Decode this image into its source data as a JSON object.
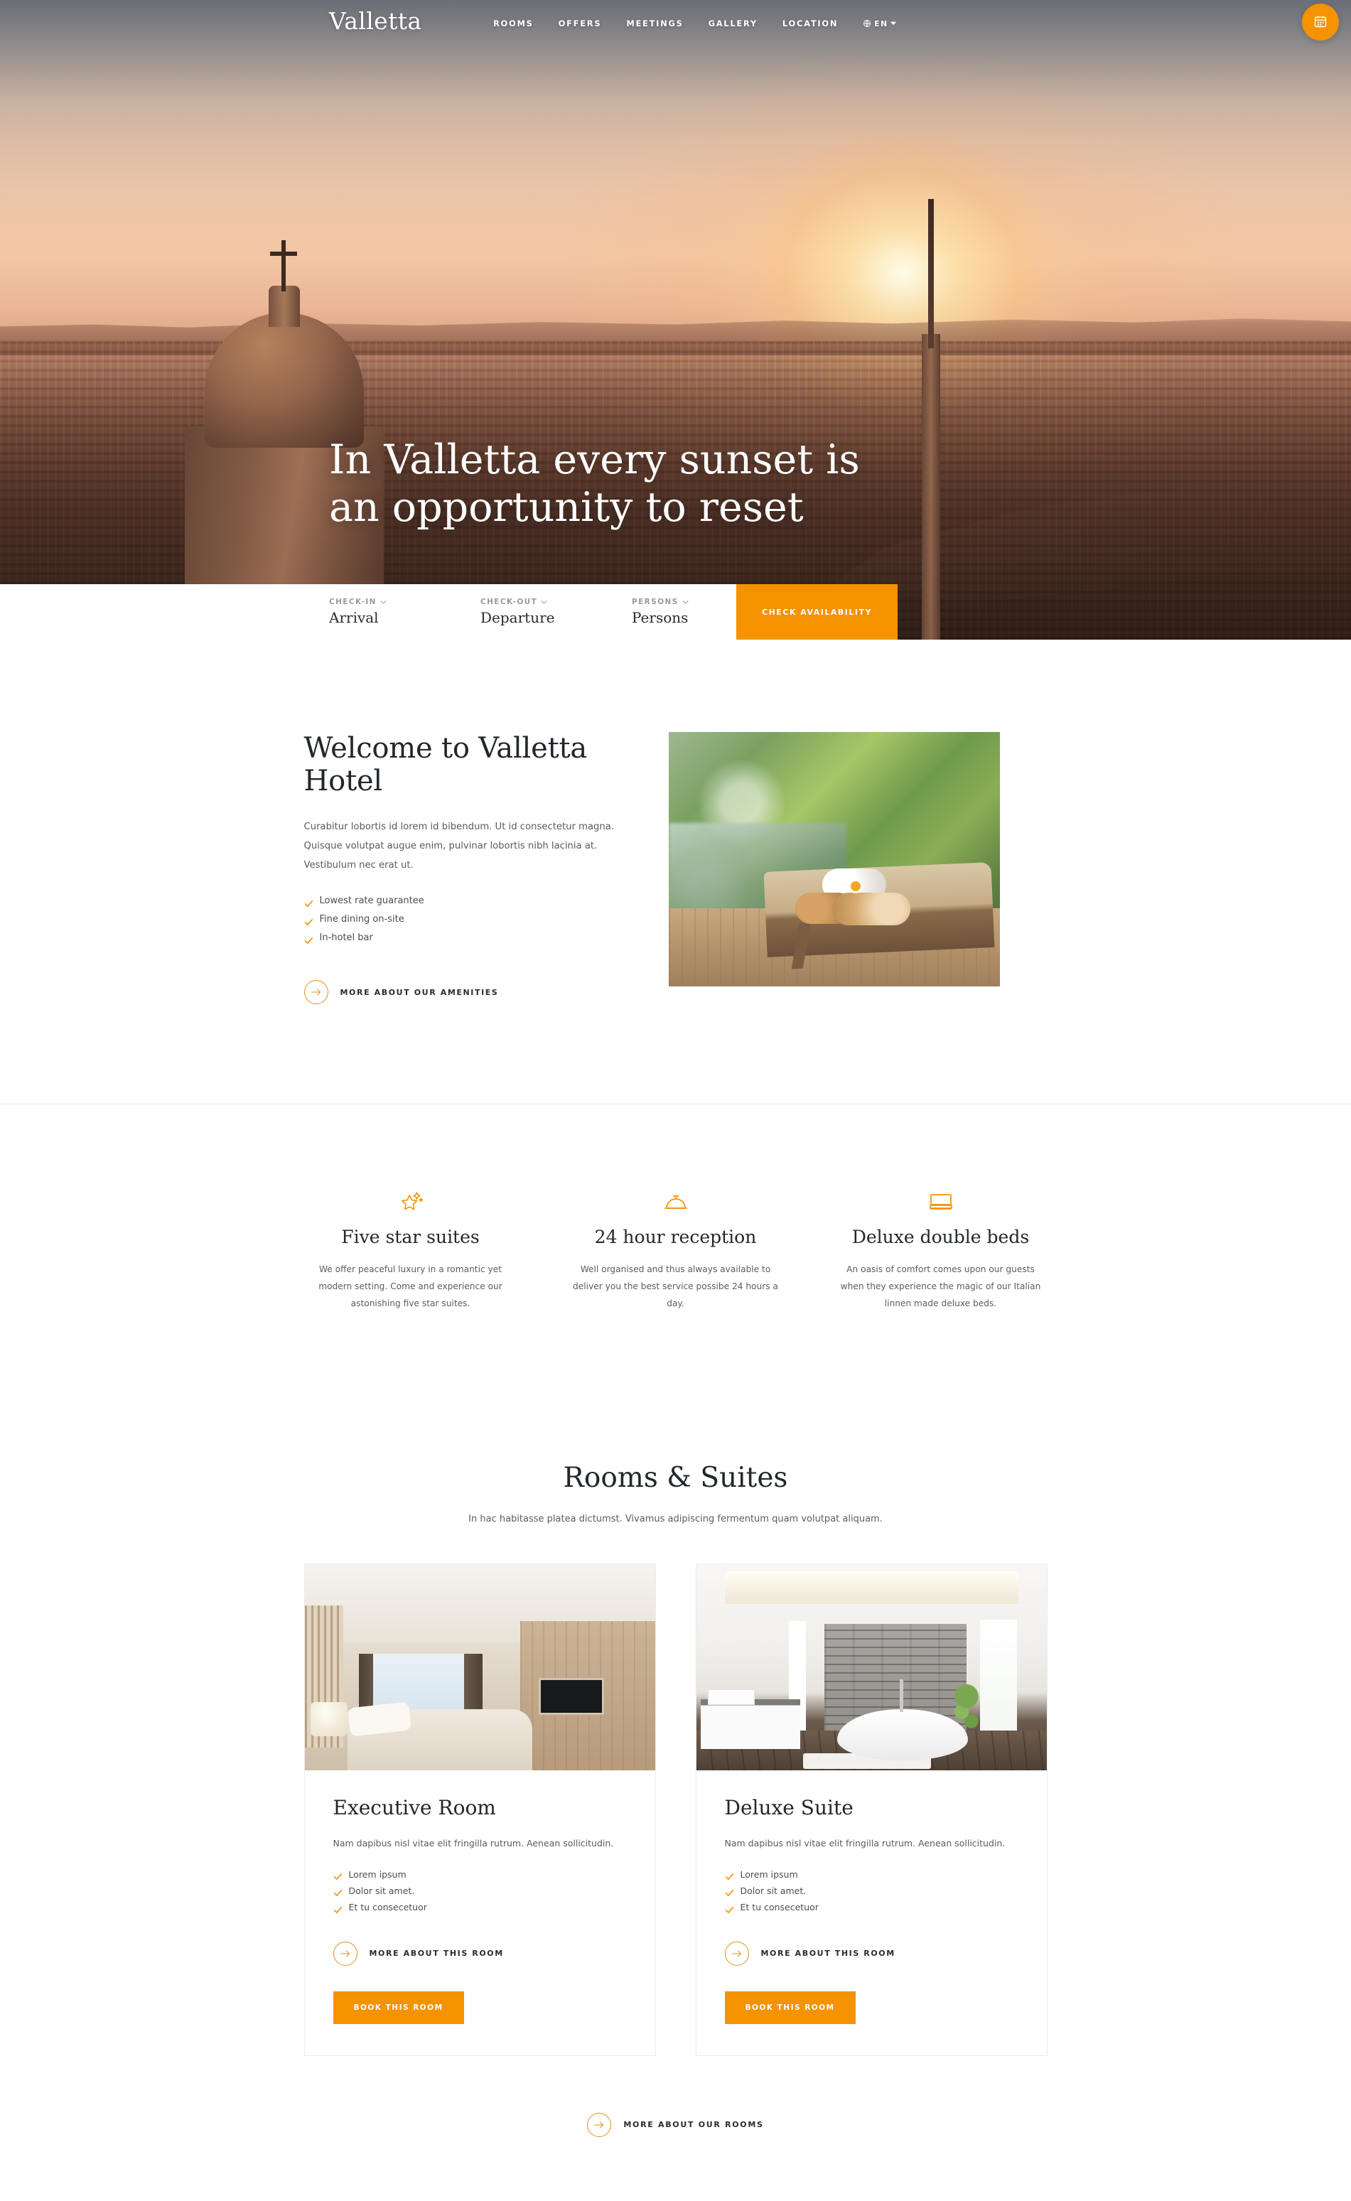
{
  "brand": {
    "name": "Valletta",
    "accent": "#f59200",
    "accent_dark": "#e0921f"
  },
  "header": {
    "nav": [
      {
        "label": "ROOMS"
      },
      {
        "label": "OFFERS"
      },
      {
        "label": "MEETINGS"
      },
      {
        "label": "GALLERY"
      },
      {
        "label": "LOCATION"
      }
    ],
    "language": {
      "label": "EN",
      "icon": "globe-icon",
      "caret": "caret-down-icon"
    },
    "booking_fab": {
      "icon": "calendar-icon"
    }
  },
  "hero": {
    "title_line1": "In Valletta every sunset is",
    "title_line2": "an opportunity to reset"
  },
  "booking": {
    "fields": [
      {
        "label": "CHECK-IN",
        "value": "Arrival"
      },
      {
        "label": "CHECK-OUT",
        "value": "Departure"
      },
      {
        "label": "PERSONS",
        "value": "Persons"
      }
    ],
    "submit_label": "CHECK AVAILABILITY"
  },
  "welcome": {
    "heading": "Welcome to Valletta Hotel",
    "paragraph": "Curabitur lobortis id lorem id bibendum. Ut id consectetur magna. Quisque volutpat augue enim, pulvinar lobortis nibh lacinia at. Vestibulum nec erat ut.",
    "checklist": [
      "Lowest rate guarantee",
      "Fine dining on-site",
      "In-hotel bar"
    ],
    "cta_label": "MORE ABOUT OUR AMENITIES",
    "image_alt": "spa-towels-on-lounger"
  },
  "features": [
    {
      "icon": "star-sparkle-icon",
      "title": "Five star suites",
      "text": "We offer peaceful luxury in a romantic yet modern setting. Come and experience our astonishing five star suites."
    },
    {
      "icon": "service-bell-icon",
      "title": "24 hour reception",
      "text": "Well organised and thus always available to deliver you the best service possibe 24 hours a day."
    },
    {
      "icon": "bed-icon",
      "title": "Deluxe double beds",
      "text": "An oasis of comfort comes upon our guests when they experience the magic of our Italian linnen made deluxe beds."
    }
  ],
  "rooms_section": {
    "heading": "Rooms & Suites",
    "subheading": "In hac habitasse platea dictumst. Vivamus adipiscing fermentum quam volutpat aliquam.",
    "cta_label": "MORE ABOUT OUR ROOMS",
    "cards": [
      {
        "title": "Executive Room",
        "text": "Nam dapibus nisl vitae elit fringilla rutrum. Aenean sollicitudin.",
        "features": [
          "Lorem ipsum",
          "Dolor sit amet.",
          "Et tu consecetuor"
        ],
        "more_label": "MORE ABOUT THIS ROOM",
        "book_label": "BOOK THIS ROOM",
        "image_alt": "executive-bedroom-photo"
      },
      {
        "title": "Deluxe Suite",
        "text": "Nam dapibus nisl vitae elit fringilla rutrum. Aenean sollicitudin.",
        "features": [
          "Lorem ipsum",
          "Dolor sit amet.",
          "Et tu consecetuor"
        ],
        "more_label": "MORE ABOUT THIS ROOM",
        "book_label": "BOOK THIS ROOM",
        "image_alt": "deluxe-suite-bathroom-photo"
      }
    ]
  }
}
